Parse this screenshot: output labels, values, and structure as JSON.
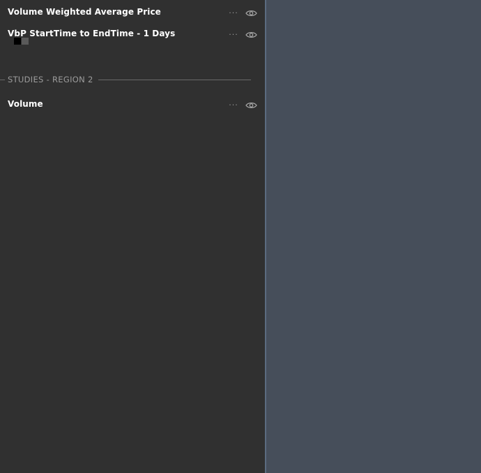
{
  "studies_region_1": [
    {
      "name": "Volume Weighted Average Price",
      "more_label": "..."
    },
    {
      "name": "VbP StartTime to EndTime - 1 Days",
      "more_label": "...",
      "swatches": [
        "#000000",
        "#5a5a5a"
      ]
    }
  ],
  "region_2": {
    "title": "STUDIES - REGION 2",
    "studies": [
      {
        "name": "Volume",
        "more_label": "..."
      }
    ]
  },
  "colors": {
    "panel_bg": "#303030",
    "chart_bg": "#464e5a",
    "divider": "#5b6b80",
    "text": "#ffffff",
    "muted": "#9c9c9c"
  },
  "icons": {
    "more": "more-icon",
    "visibility": "eye-icon"
  }
}
